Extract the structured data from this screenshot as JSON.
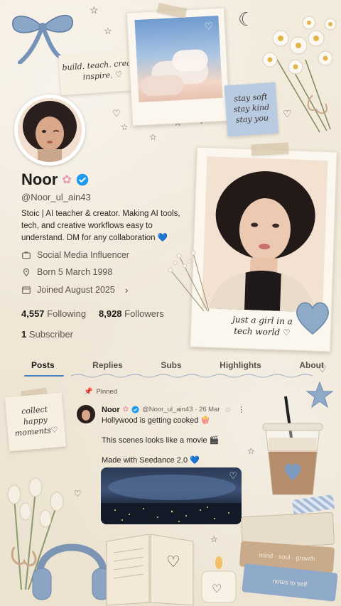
{
  "notes": {
    "top_left": [
      "build. teach. create.",
      "inspire. ♡"
    ],
    "top_right": [
      "stay soft",
      "stay kind",
      "stay you"
    ],
    "photo_caption": [
      "just a girl in a",
      "tech world ♡"
    ],
    "collect": [
      "collect",
      "happy",
      "moments♡"
    ]
  },
  "profile": {
    "name": "Noor",
    "handle": "@Noor_ul_ain43",
    "bio": "Stoic | AI teacher & creator. Making AI tools, tech, and creative workflows easy to understand. DM for any collaboration 💙",
    "category": "Social Media Influencer",
    "born": "Born 5 March 1998",
    "joined": "Joined August 2025",
    "following_count": "4,557",
    "following_label": "Following",
    "followers_count": "8,928",
    "followers_label": "Followers",
    "subscriber_count": "1",
    "subscriber_label": "Subscriber"
  },
  "tabs": [
    "Posts",
    "Replies",
    "Subs",
    "Highlights",
    "About"
  ],
  "post": {
    "pinned_label": "Pinned",
    "name": "Noor",
    "handle_date": "@Noor_ul_ain43 · 26 Mar",
    "line1": "Hollywood is getting cooked 🍿",
    "line2": "This scenes looks like a movie 🎬",
    "line3": "Made with Seedance 2.0 💙"
  },
  "books": [
    "mind · soul · growth",
    "notes to self"
  ],
  "colors": {
    "background": "#efe6d6",
    "verified": "#1d9bf0",
    "tab_underline": "#4a7fb5",
    "accent_blue": "#7e9bbf"
  }
}
